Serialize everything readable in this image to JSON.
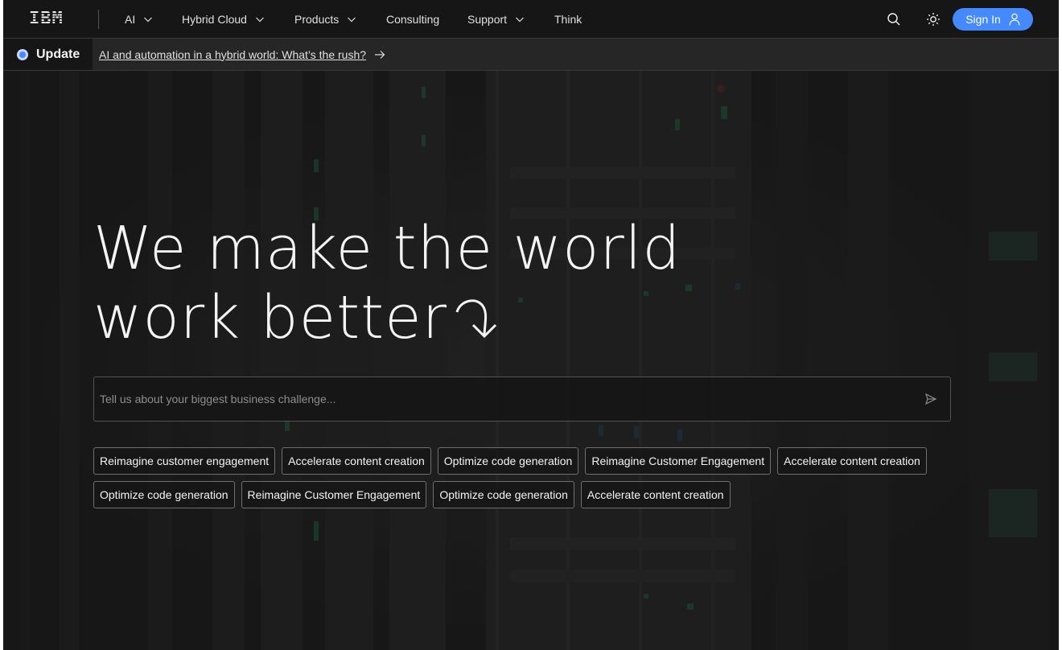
{
  "brand": {
    "logo_text": "IBM"
  },
  "nav": {
    "items": [
      {
        "label": "AI",
        "has_menu": true
      },
      {
        "label": "Hybrid Cloud",
        "has_menu": true
      },
      {
        "label": "Products",
        "has_menu": true
      },
      {
        "label": "Consulting",
        "has_menu": false
      },
      {
        "label": "Support",
        "has_menu": true
      },
      {
        "label": "Think",
        "has_menu": false
      }
    ],
    "search_icon": "search-icon",
    "theme_icon": "sun-icon",
    "sign_in_label": "Sign In",
    "sign_in_icon": "user-icon"
  },
  "update_bar": {
    "label": "Update",
    "link_text": "AI and automation in a hybrid world: What’s the rush?",
    "link_icon": "arrow-right-icon"
  },
  "hero": {
    "title_line_1": "We make the world",
    "title_line_2": "work better",
    "title_icon": "turn-down-arrow-icon",
    "input_placeholder": "Tell us about your biggest business challenge...",
    "send_icon": "send-icon",
    "chips_row_1": [
      "Reimagine customer engagement",
      "Accelerate content creation",
      "Optimize code generation",
      "Reimagine Customer Engagement",
      "Accelerate content creation"
    ],
    "chips_row_2": [
      "Optimize code generation",
      "Reimagine Customer Engagement",
      "Optimize code generation",
      "Accelerate content creation"
    ]
  },
  "colors": {
    "background": "#161616",
    "accent": "#4589ff",
    "text": "#f4f4f4",
    "update_bar": "#262626",
    "border": "#525252"
  }
}
